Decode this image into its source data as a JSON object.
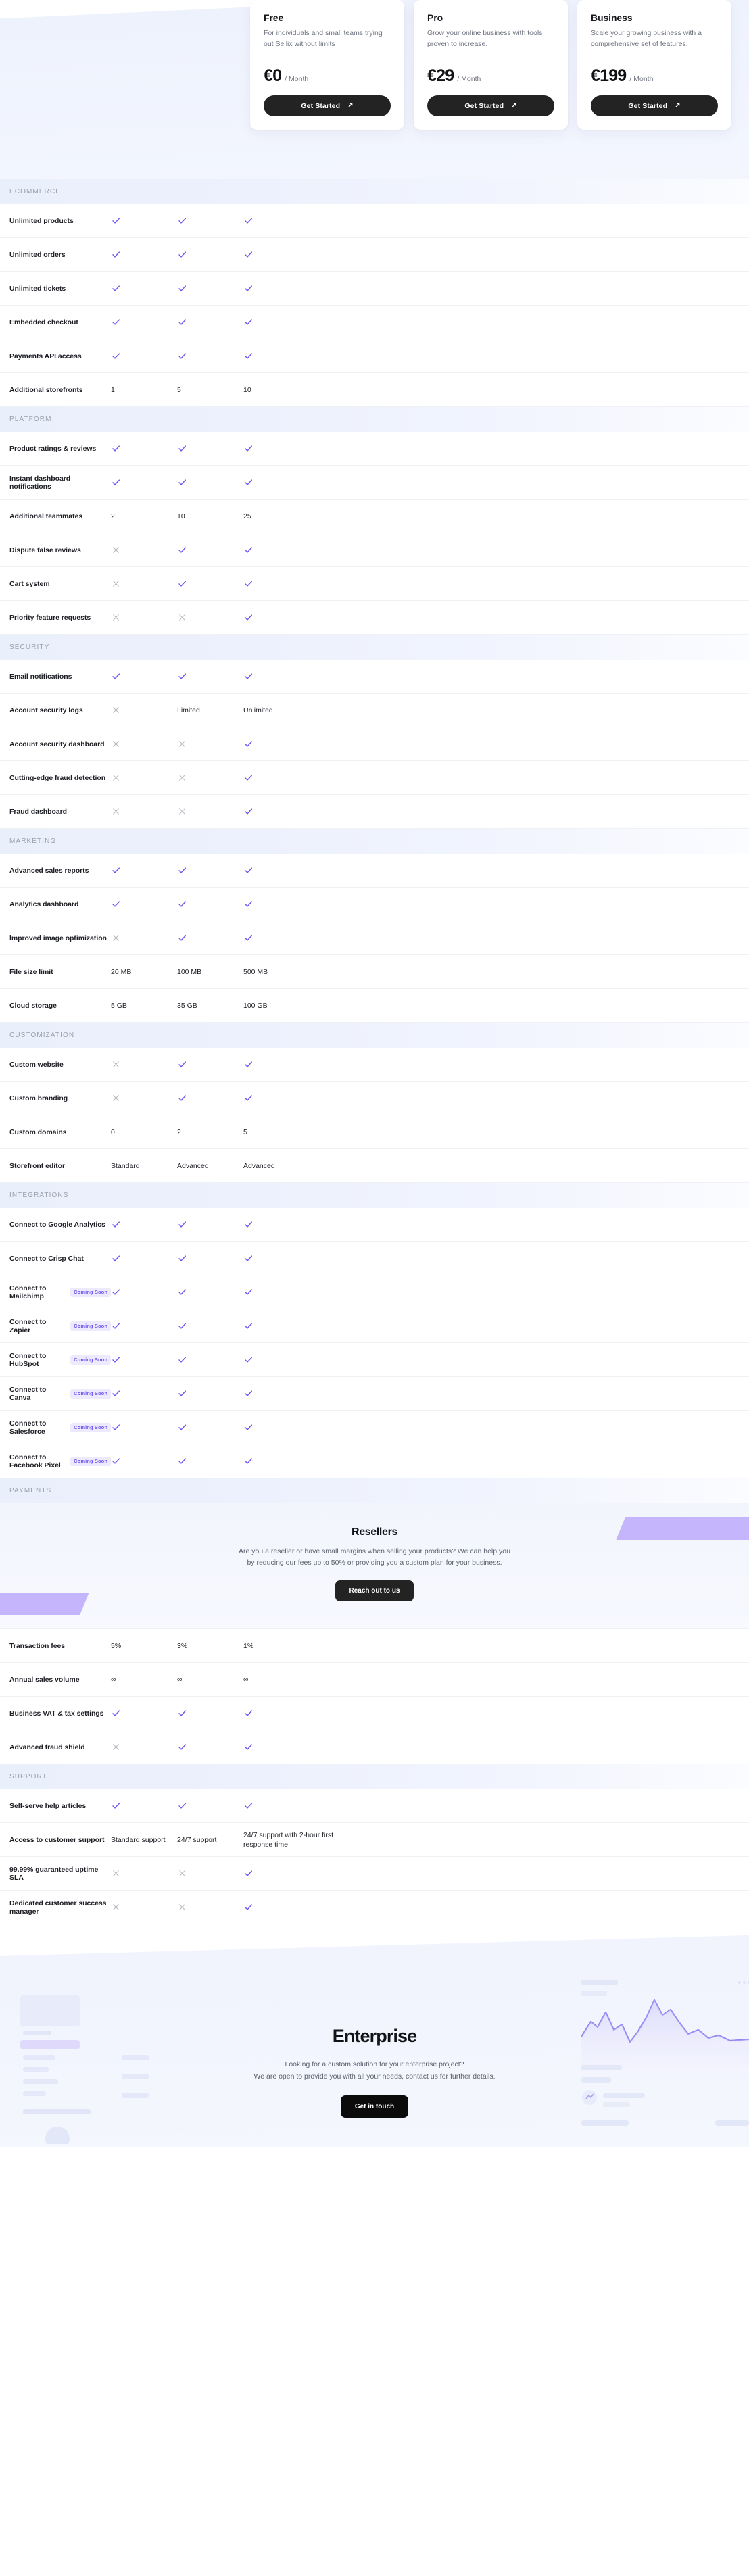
{
  "plans": [
    {
      "name": "Free",
      "description": "For individuals and small teams trying out Sellix without limits",
      "price": "€0",
      "period": "/ Month",
      "cta": "Get Started"
    },
    {
      "name": "Pro",
      "description": "Grow your online business with tools proven to increase.",
      "price": "€29",
      "period": "/ Month",
      "cta": "Get Started"
    },
    {
      "name": "Business",
      "description": "Scale your growing business with a comprehensive set of features.",
      "price": "€199",
      "period": "/ Month",
      "cta": "Get Started"
    }
  ],
  "colors": {
    "check": "#6f55f0",
    "cross": "#b9bcc4",
    "badge_bg": "#eeeafd",
    "badge_text": "#6f55f0",
    "cta_bg": "#232323",
    "band": "#c4b5fd"
  },
  "icon_names": {
    "check": "check-icon",
    "cross": "cross-icon",
    "arrow": "arrow-up-right-icon"
  },
  "sections": [
    {
      "title": "ECOMMERCE",
      "rows": [
        {
          "label": "Unlimited products",
          "badge": null,
          "values": [
            "check",
            "check",
            "check"
          ]
        },
        {
          "label": "Unlimited orders",
          "badge": null,
          "values": [
            "check",
            "check",
            "check"
          ]
        },
        {
          "label": "Unlimited tickets",
          "badge": null,
          "values": [
            "check",
            "check",
            "check"
          ]
        },
        {
          "label": "Embedded checkout",
          "badge": null,
          "values": [
            "check",
            "check",
            "check"
          ]
        },
        {
          "label": "Payments API access",
          "badge": null,
          "values": [
            "check",
            "check",
            "check"
          ]
        },
        {
          "label": "Additional storefronts",
          "badge": null,
          "values": [
            "1",
            "5",
            "10"
          ]
        }
      ]
    },
    {
      "title": "PLATFORM",
      "rows": [
        {
          "label": "Product ratings & reviews",
          "badge": null,
          "values": [
            "check",
            "check",
            "check"
          ]
        },
        {
          "label": "Instant dashboard notifications",
          "badge": null,
          "values": [
            "check",
            "check",
            "check"
          ]
        },
        {
          "label": "Additional teammates",
          "badge": null,
          "values": [
            "2",
            "10",
            "25"
          ]
        },
        {
          "label": "Dispute false reviews",
          "badge": null,
          "values": [
            "cross",
            "check",
            "check"
          ]
        },
        {
          "label": "Cart system",
          "badge": null,
          "values": [
            "cross",
            "check",
            "check"
          ]
        },
        {
          "label": "Priority feature requests",
          "badge": null,
          "values": [
            "cross",
            "cross",
            "check"
          ]
        }
      ]
    },
    {
      "title": "SECURITY",
      "rows": [
        {
          "label": "Email notifications",
          "badge": null,
          "values": [
            "check",
            "check",
            "check"
          ]
        },
        {
          "label": "Account security logs",
          "badge": null,
          "values": [
            "cross",
            "Limited",
            "Unlimited"
          ]
        },
        {
          "label": "Account security dashboard",
          "badge": null,
          "values": [
            "cross",
            "cross",
            "check"
          ]
        },
        {
          "label": "Cutting-edge fraud detection",
          "badge": null,
          "values": [
            "cross",
            "cross",
            "check"
          ]
        },
        {
          "label": "Fraud dashboard",
          "badge": null,
          "values": [
            "cross",
            "cross",
            "check"
          ]
        }
      ]
    },
    {
      "title": "MARKETING",
      "rows": [
        {
          "label": "Advanced sales reports",
          "badge": null,
          "values": [
            "check",
            "check",
            "check"
          ]
        },
        {
          "label": "Analytics dashboard",
          "badge": null,
          "values": [
            "check",
            "check",
            "check"
          ]
        },
        {
          "label": "Improved image optimization",
          "badge": null,
          "values": [
            "cross",
            "check",
            "check"
          ]
        },
        {
          "label": "File size limit",
          "badge": null,
          "values": [
            "20 MB",
            "100 MB",
            "500 MB"
          ]
        },
        {
          "label": "Cloud storage",
          "badge": null,
          "values": [
            "5 GB",
            "35 GB",
            "100 GB"
          ]
        }
      ]
    },
    {
      "title": "CUSTOMIZATION",
      "rows": [
        {
          "label": "Custom website",
          "badge": null,
          "values": [
            "cross",
            "check",
            "check"
          ]
        },
        {
          "label": "Custom branding",
          "badge": null,
          "values": [
            "cross",
            "check",
            "check"
          ]
        },
        {
          "label": "Custom domains",
          "badge": null,
          "values": [
            "0",
            "2",
            "5"
          ]
        },
        {
          "label": "Storefront editor",
          "badge": null,
          "values": [
            "Standard",
            "Advanced",
            "Advanced"
          ]
        }
      ]
    },
    {
      "title": "INTEGRATIONS",
      "rows": [
        {
          "label": "Connect to Google Analytics",
          "badge": null,
          "values": [
            "check",
            "check",
            "check"
          ]
        },
        {
          "label": "Connect to Crisp Chat",
          "badge": null,
          "values": [
            "check",
            "check",
            "check"
          ]
        },
        {
          "label": "Connect to Mailchimp",
          "badge": "Coming Soon",
          "values": [
            "check",
            "check",
            "check"
          ]
        },
        {
          "label": "Connect to Zapier",
          "badge": "Coming Soon",
          "values": [
            "check",
            "check",
            "check"
          ]
        },
        {
          "label": "Connect to HubSpot",
          "badge": "Coming Soon",
          "values": [
            "check",
            "check",
            "check"
          ]
        },
        {
          "label": "Connect to Canva",
          "badge": "Coming Soon",
          "values": [
            "check",
            "check",
            "check"
          ]
        },
        {
          "label": "Connect to Salesforce",
          "badge": "Coming Soon",
          "values": [
            "check",
            "check",
            "check"
          ]
        },
        {
          "label": "Connect to Facebook Pixel",
          "badge": "Coming Soon",
          "values": [
            "check",
            "check",
            "check"
          ]
        }
      ]
    },
    {
      "title": "PAYMENTS",
      "banner": {
        "title": "Resellers",
        "line1": "Are you a reseller or have small margins when selling your products? We can help you",
        "line2": "by reducing our fees up to 50% or providing you a custom plan for your business.",
        "cta": "Reach out to us"
      },
      "rows": [
        {
          "label": "Transaction fees",
          "badge": null,
          "values": [
            "5%",
            "3%",
            "1%"
          ]
        },
        {
          "label": "Annual sales volume",
          "badge": null,
          "values": [
            "∞",
            "∞",
            "∞"
          ]
        },
        {
          "label": "Business VAT & tax settings",
          "badge": null,
          "values": [
            "check",
            "check",
            "check"
          ]
        },
        {
          "label": "Advanced fraud shield",
          "badge": null,
          "values": [
            "cross",
            "check",
            "check"
          ]
        }
      ]
    },
    {
      "title": "SUPPORT",
      "rows": [
        {
          "label": "Self-serve help articles",
          "badge": null,
          "values": [
            "check",
            "check",
            "check"
          ]
        },
        {
          "label": "Access to customer support",
          "badge": null,
          "values": [
            "Standard support",
            "24/7 support",
            "24/7 support with 2-hour first response time"
          ]
        },
        {
          "label": "99.99% guaranteed uptime SLA",
          "badge": null,
          "values": [
            "cross",
            "cross",
            "check"
          ]
        },
        {
          "label": "Dedicated customer success manager",
          "badge": null,
          "values": [
            "cross",
            "cross",
            "check"
          ]
        }
      ]
    }
  ],
  "enterprise": {
    "title": "Enterprise",
    "line1": "Looking for a custom solution for your enterprise project?",
    "line2": "We are open to provide you with all your needs, contact us for further details.",
    "cta": "Get in touch"
  }
}
